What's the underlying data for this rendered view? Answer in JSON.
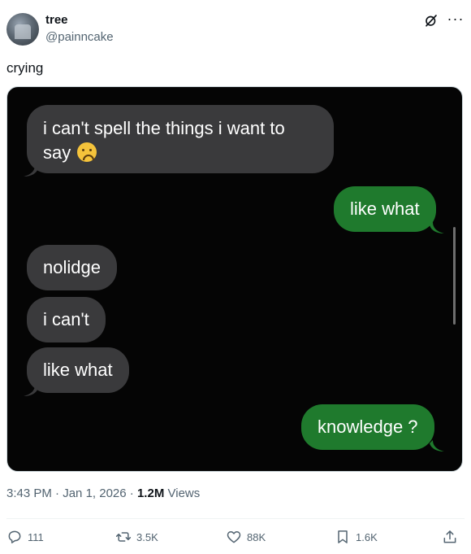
{
  "author": {
    "name": "tree",
    "handle": "@painncake"
  },
  "tweet": {
    "text": "crying"
  },
  "media": {
    "messages": [
      {
        "side": "left",
        "text": "i can't spell the things i want to say",
        "emoji": "frowning-face-emoji"
      },
      {
        "side": "right",
        "text": "like what"
      },
      {
        "side": "left",
        "text": "nolidge"
      },
      {
        "side": "left",
        "text": "i can't"
      },
      {
        "side": "left",
        "text": "like what"
      },
      {
        "side": "right",
        "text": "knowledge ?"
      }
    ]
  },
  "meta": {
    "time": "3:43 PM",
    "sep1": "·",
    "date": "Jan 1, 2026",
    "sep2": "·",
    "views_count": "1.2M",
    "views_label": "Views"
  },
  "actions": {
    "replies": "111",
    "reposts": "3.5K",
    "likes": "88K",
    "bookmarks": "1.6K"
  },
  "icons": {
    "grok": "grok-icon",
    "more": "more-icon",
    "reply": "reply-icon",
    "repost": "repost-icon",
    "like": "heart-icon",
    "bookmark": "bookmark-icon",
    "share": "share-icon"
  },
  "colors": {
    "imessage_green": "#1f7a2d",
    "bubble_grey": "#3a3a3c",
    "secondary_text": "#536471"
  }
}
